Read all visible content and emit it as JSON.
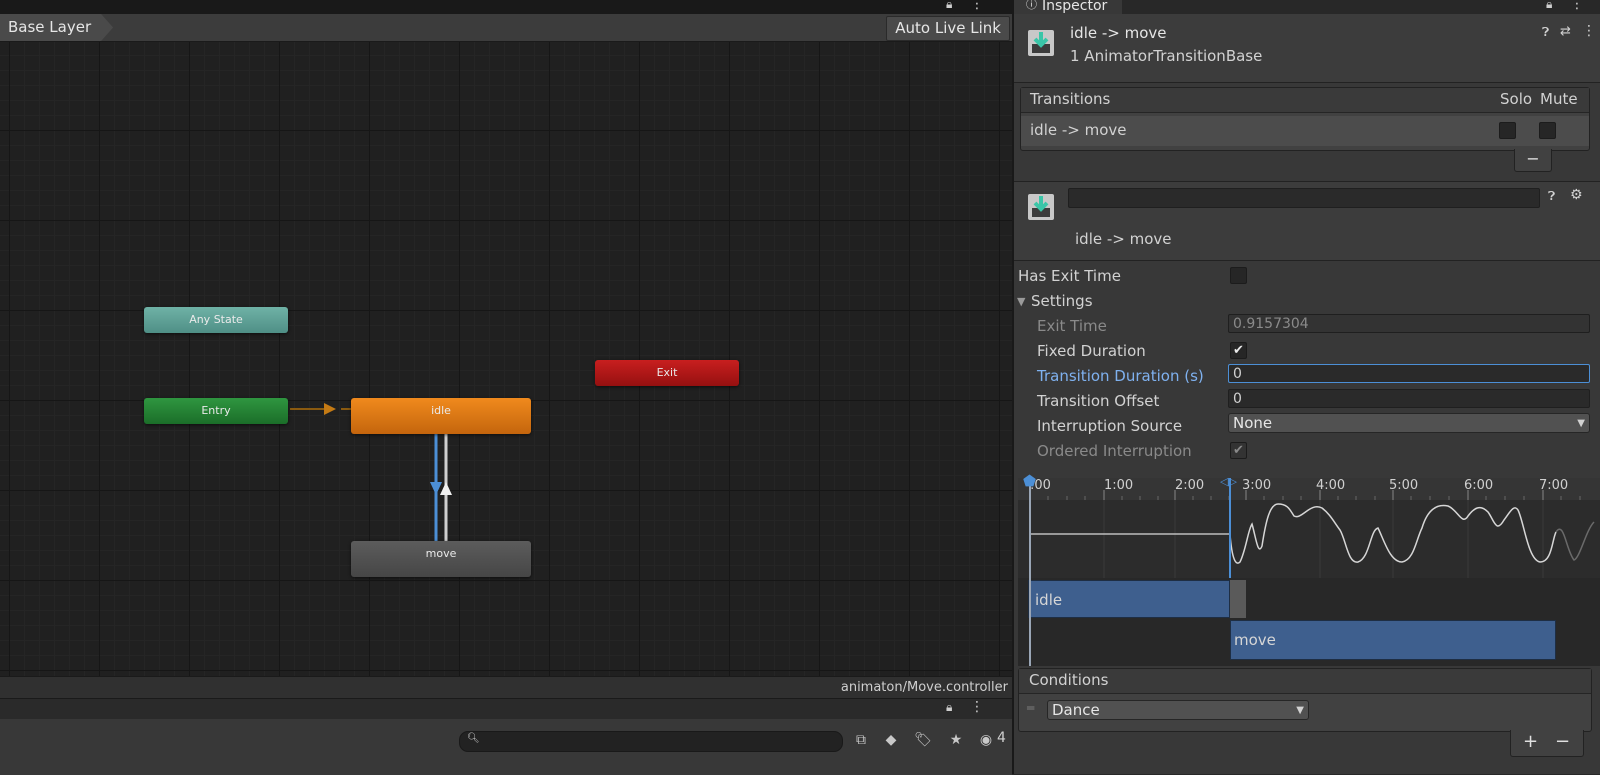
{
  "animator": {
    "layer_breadcrumb": "Base Layer",
    "auto_live_link": "Auto Live Link",
    "nodes": {
      "any_state": "Any State",
      "entry": "Entry",
      "exit": "Exit",
      "idle": "idle",
      "move": "move"
    },
    "footer_path": "animaton/Move.controller",
    "hidden_count": "4"
  },
  "inspector": {
    "tab_label": "Inspector",
    "header": {
      "title": "idle -> move",
      "subtitle": "1 AnimatorTransitionBase"
    },
    "transitions": {
      "header": "Transitions",
      "solo_label": "Solo",
      "mute_label": "Mute",
      "row_label": "idle -> move",
      "remove_label": "−"
    },
    "transition_detail": {
      "name_value": "",
      "label": "idle -> move"
    },
    "has_exit_time_label": "Has Exit Time",
    "settings_label": "Settings",
    "exit_time": {
      "label": "Exit Time",
      "value": "0.9157304"
    },
    "fixed_duration": {
      "label": "Fixed Duration",
      "checked": true
    },
    "transition_duration": {
      "label": "Transition Duration (s)",
      "value": "0"
    },
    "transition_offset": {
      "label": "Transition Offset",
      "value": "0"
    },
    "interruption_source": {
      "label": "Interruption Source",
      "value": "None"
    },
    "ordered_interruption": {
      "label": "Ordered Interruption",
      "checked": true
    },
    "timeline": {
      "ticks": [
        ":00",
        "1:00",
        "2:00",
        "3:00",
        "4:00",
        "5:00",
        "6:00",
        "7:00"
      ],
      "clip_idle": "idle",
      "clip_move": "move"
    },
    "conditions": {
      "header": "Conditions",
      "parameter": "Dance",
      "add_label": "+",
      "remove_label": "−"
    },
    "colors": {
      "accent": "#4c8fd6",
      "idle_node": "#e07b16",
      "entry_node": "#23802f",
      "any_state_node": "#5fa298",
      "exit_node": "#b01717",
      "clip_blue": "#3e5f8e"
    }
  }
}
